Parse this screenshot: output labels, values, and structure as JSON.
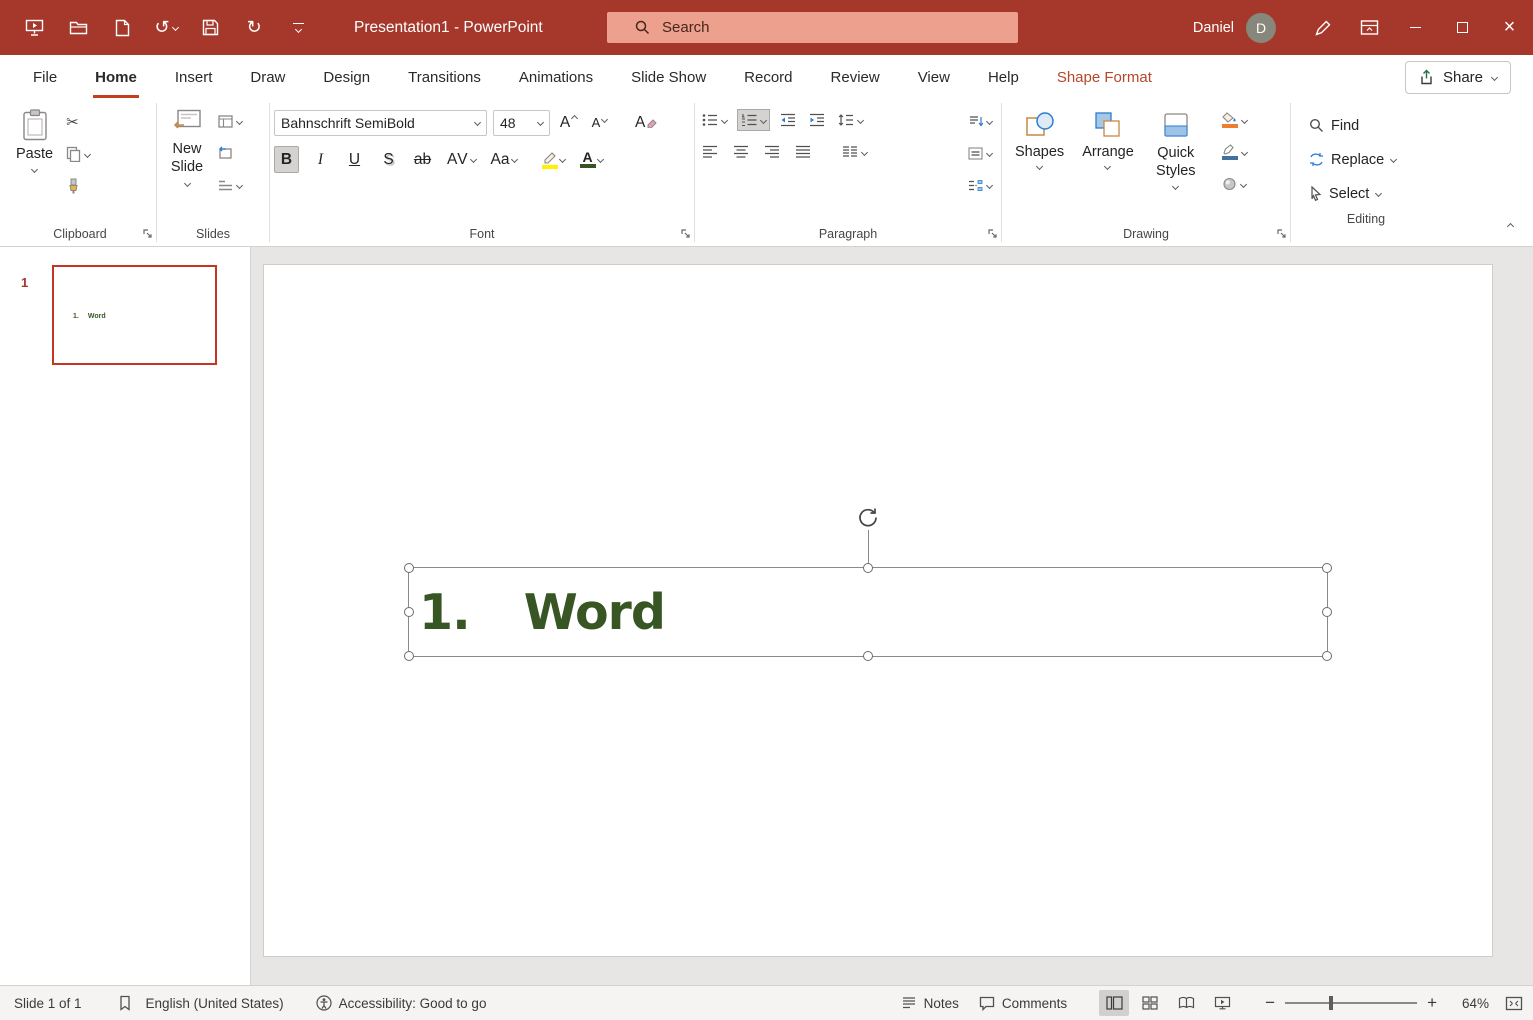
{
  "icons": {
    "scissors": "✂",
    "undo": "↺",
    "redo": "↻",
    "close": "×",
    "minus": "−",
    "plus": "+"
  },
  "title_bar": {
    "title": "Presentation1  -  PowerPoint",
    "search": "Search",
    "user": "Daniel",
    "avatar": "D"
  },
  "tabs": [
    {
      "label": "File"
    },
    {
      "label": "Home"
    },
    {
      "label": "Insert"
    },
    {
      "label": "Draw"
    },
    {
      "label": "Design"
    },
    {
      "label": "Transitions"
    },
    {
      "label": "Animations"
    },
    {
      "label": "Slide Show"
    },
    {
      "label": "Record"
    },
    {
      "label": "Review"
    },
    {
      "label": "View"
    },
    {
      "label": "Help"
    },
    {
      "label": "Shape Format"
    }
  ],
  "share": "Share",
  "g": {
    "clipboard": {
      "label": "Clipboard",
      "paste": "Paste"
    },
    "slides": {
      "label": "Slides",
      "new_slide": "New Slide"
    },
    "font": {
      "label": "Font",
      "name": "Bahnschrift SemiBold",
      "size": "48",
      "bold": "B",
      "italic": "I",
      "underline": "U",
      "shadow": "S",
      "strike": "ab",
      "spacing": "AV",
      "case": "Aa",
      "grow": "A",
      "shrink": "A",
      "clear": "A",
      "color": "A"
    },
    "paragraph": {
      "label": "Paragraph"
    },
    "drawing": {
      "label": "Drawing",
      "shapes": "Shapes",
      "arrange": "Arrange",
      "quick": "Quick Styles"
    },
    "editing": {
      "label": "Editing",
      "find": "Find",
      "replace": "Replace",
      "select": "Select"
    }
  },
  "panel": {
    "number": "1"
  },
  "slide": {
    "num": "1.",
    "word": "Word"
  },
  "status": {
    "slides": "Slide 1 of 1",
    "lang": "English (United States)",
    "access": "Accessibility: Good to go",
    "notes": "Notes",
    "comments": "Comments",
    "zoom": "64%"
  },
  "colors": {
    "titlebar": "#A5372B",
    "accent": "#C43E1C",
    "slide_text": "#375623",
    "highlight": "#FFF100",
    "fill_bar": "#ED7D31",
    "outline_bar": "#41719C"
  }
}
